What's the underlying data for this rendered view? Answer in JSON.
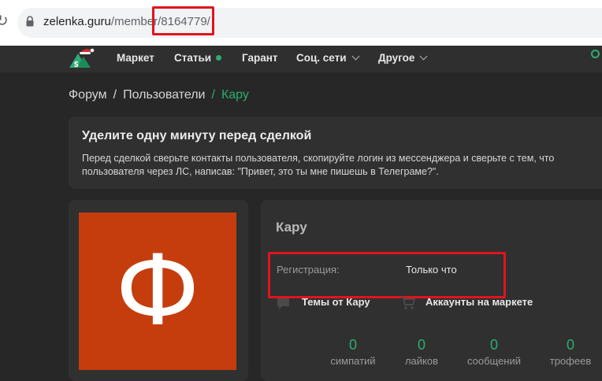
{
  "browser": {
    "url_host": "zelenka.guru",
    "url_path": "/member",
    "url_id": "/8164779/",
    "reload_icon": "reload-icon",
    "lock_icon": "lock-icon"
  },
  "nav": {
    "logo_icon": "site-logo",
    "items": [
      {
        "label": "Маркет"
      },
      {
        "label": "Статьи"
      },
      {
        "label": "Гарант"
      },
      {
        "label": "Соц. сети"
      },
      {
        "label": "Другое"
      }
    ],
    "search_icon": "search-icon",
    "accent": "#2bad72"
  },
  "breadcrumb": {
    "items": [
      "Форум",
      "Пользователи",
      "Кару"
    ],
    "separator": "/"
  },
  "notice": {
    "title": "Уделите одну минуту перед сделкой",
    "text": "Перед сделкой сверьте контакты пользователя, скопируйте логин из мессенджера и сверьте с тем, что пользователя через ЛС, написав: \"Привет, это ты мне пишешь в Телеграме?\"."
  },
  "profile": {
    "avatar_letter": "Ф",
    "avatar_color": "#c53d0d",
    "username": "Кару",
    "registration_label": "Регистрация:",
    "registration_value": "Только что",
    "links": [
      {
        "label": "Темы от Кару",
        "icon": "chat-bubble-icon"
      },
      {
        "label": "Аккаунты на маркете",
        "icon": "cart-icon"
      }
    ],
    "stats": [
      {
        "value": "0",
        "label": "симпатий"
      },
      {
        "value": "0",
        "label": "лайков"
      },
      {
        "value": "0",
        "label": "сообщений"
      },
      {
        "value": "0",
        "label": "трофеев"
      }
    ]
  },
  "highlight_color": "#e1131e"
}
